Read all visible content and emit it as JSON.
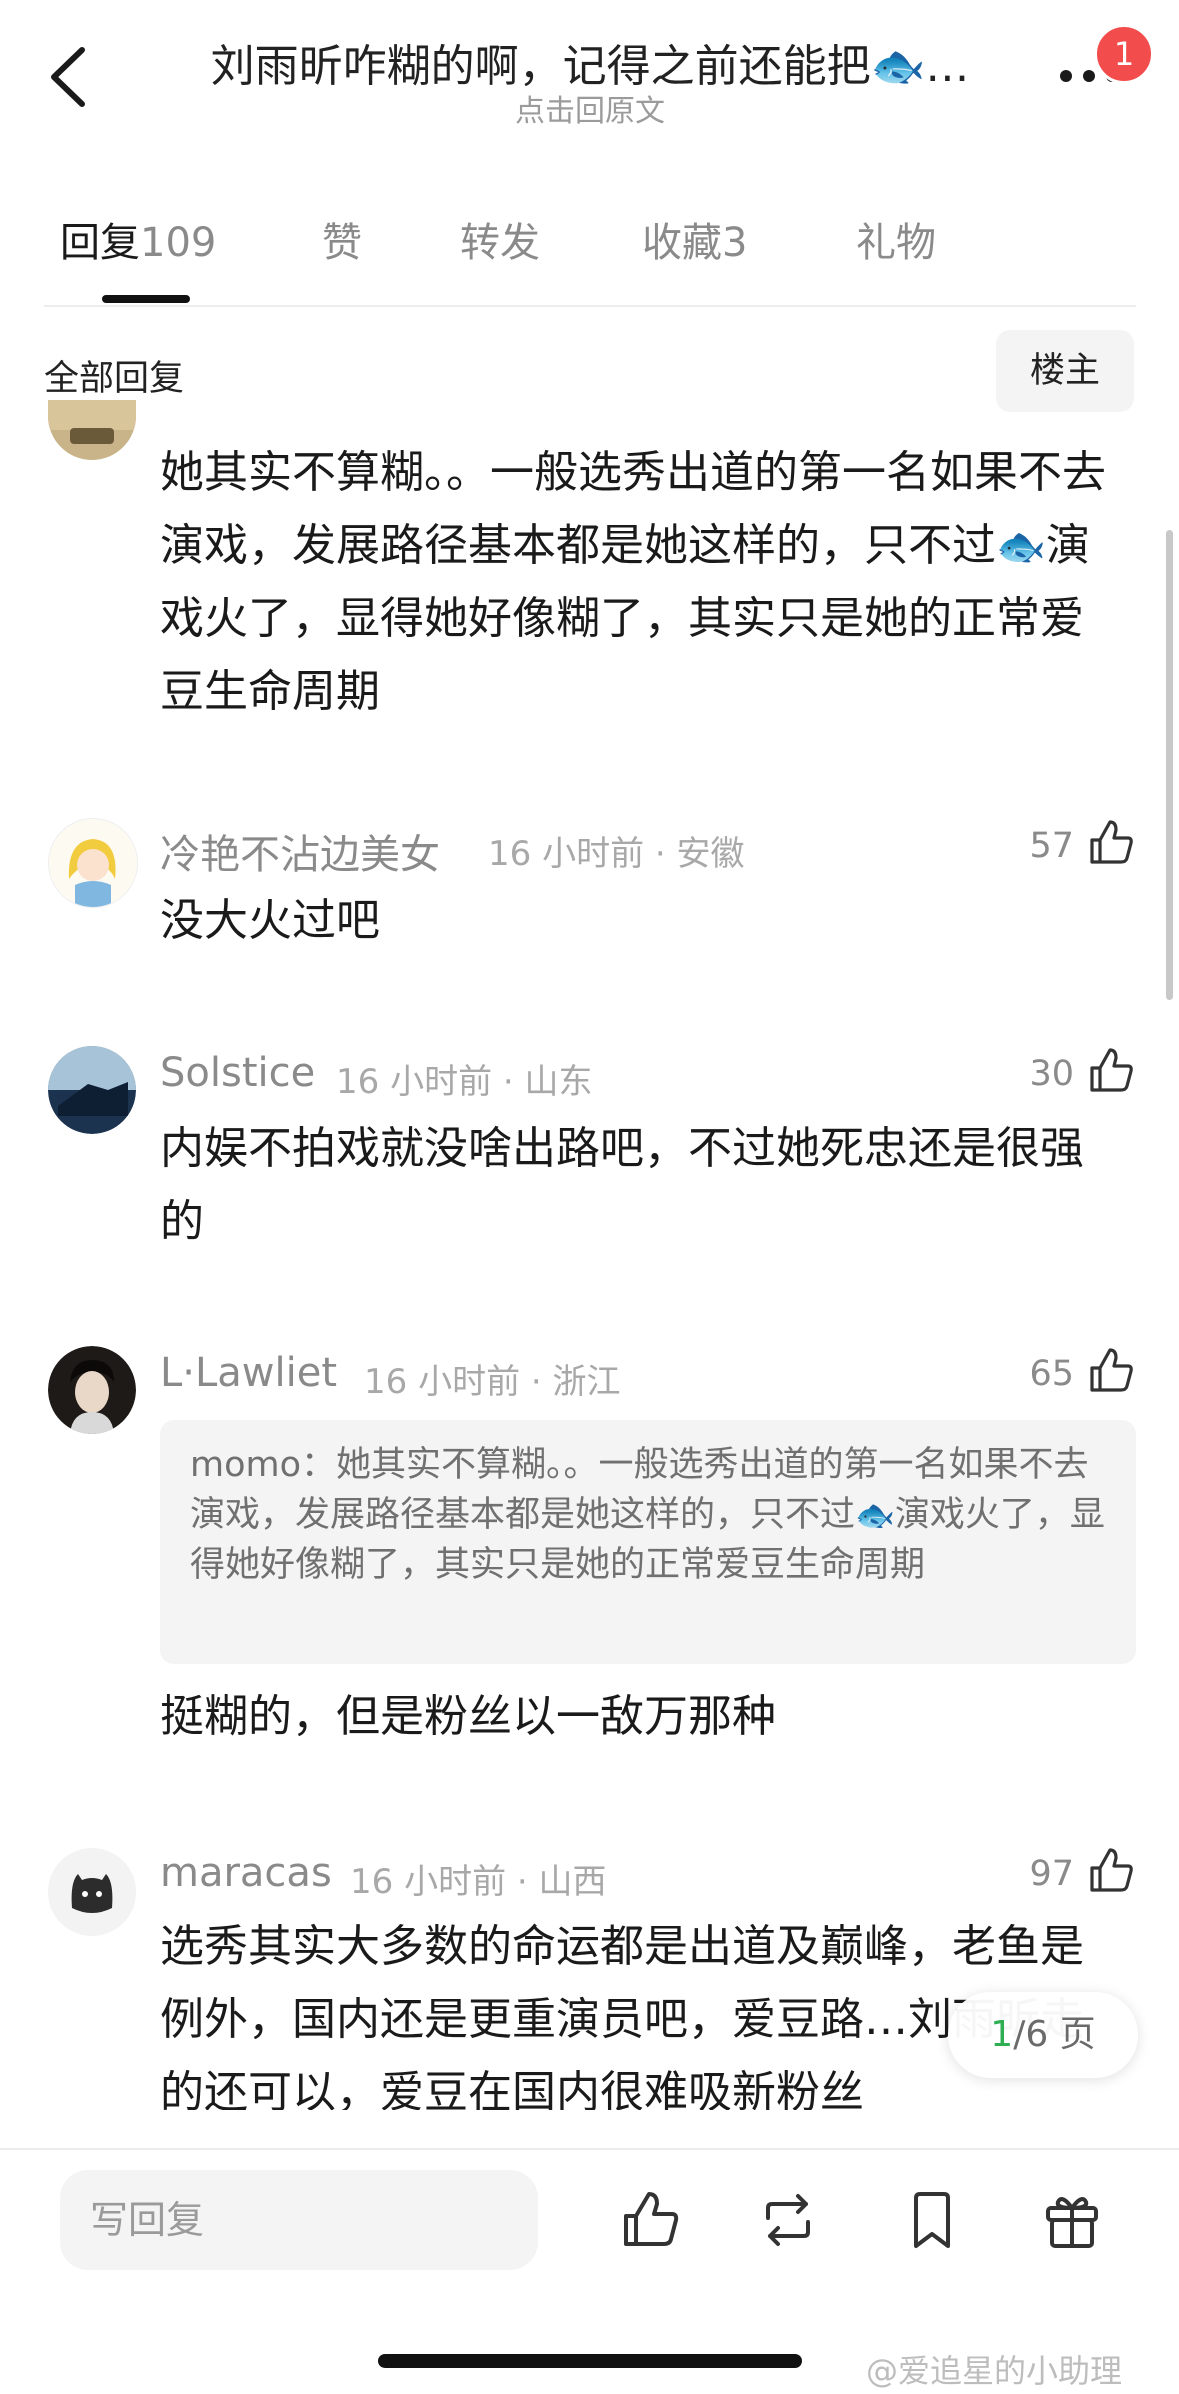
{
  "header": {
    "back_icon": "chevron-left-icon",
    "title": "刘雨昕咋糊的啊，记得之前还能把🐟…",
    "subtitle": "点击回原文",
    "more_icon": "more-dots-icon",
    "notification_count": "1"
  },
  "tabs": [
    {
      "label": "回复",
      "count": "109",
      "active": true
    },
    {
      "label": "赞",
      "count": ""
    },
    {
      "label": "转发",
      "count": ""
    },
    {
      "label": "收藏",
      "count": "3"
    },
    {
      "label": "礼物",
      "count": ""
    }
  ],
  "section": {
    "title": "全部回复",
    "filter_button": "楼主"
  },
  "comments": [
    {
      "text_before": "她其实不算糊。。一般选秀出道的第一名如果不去演戏，发展路径基本都是她这样的，只不过",
      "emoji": "🐟",
      "text_after": "演戏火了，显得她好像糊了，其实只是她的正常爱豆生命周期"
    },
    {
      "name": "冷艳不沾边美女",
      "meta": "16 小时前 · 安徽",
      "likes": "57",
      "text": "没大火过吧"
    },
    {
      "name": "Solstice",
      "meta": "16 小时前 · 山东",
      "likes": "30",
      "text": "内娱不拍戏就没啥出路吧，不过她死忠还是很强的"
    },
    {
      "name": "L·Lawliet",
      "meta": "16 小时前 · 浙江",
      "likes": "65",
      "quote_author": "momo：",
      "quote_before": "她其实不算糊。。一般选秀出道的第一名如果不去演戏，发展路径基本都是她这样的，只不过",
      "quote_emoji": "🐟",
      "quote_after": "演戏火了，显得她好像糊了，其实只是她的正常爱豆生命周期",
      "text": "挺糊的，但是粉丝以一敌万那种"
    },
    {
      "name": "maracas",
      "meta": "16 小时前 · 山西",
      "likes": "97",
      "text": "选秀其实大多数的命运都是出道及巅峰，老鱼是例外，国内还是更重演员吧，爱豆路…刘雨昕走的还可以，爱豆在国内很难吸新粉丝"
    }
  ],
  "pagination": {
    "current": "1",
    "total": "/6 页"
  },
  "bottom_bar": {
    "reply_placeholder": "写回复",
    "icons": [
      "thumbs-up-icon",
      "repost-icon",
      "bookmark-icon",
      "gift-icon"
    ]
  },
  "watermark": "@爱追星的小助理",
  "colors": {
    "accent_green": "#2fae54",
    "badge_red": "#f24c4c",
    "text_gray": "#8a8a8a"
  }
}
